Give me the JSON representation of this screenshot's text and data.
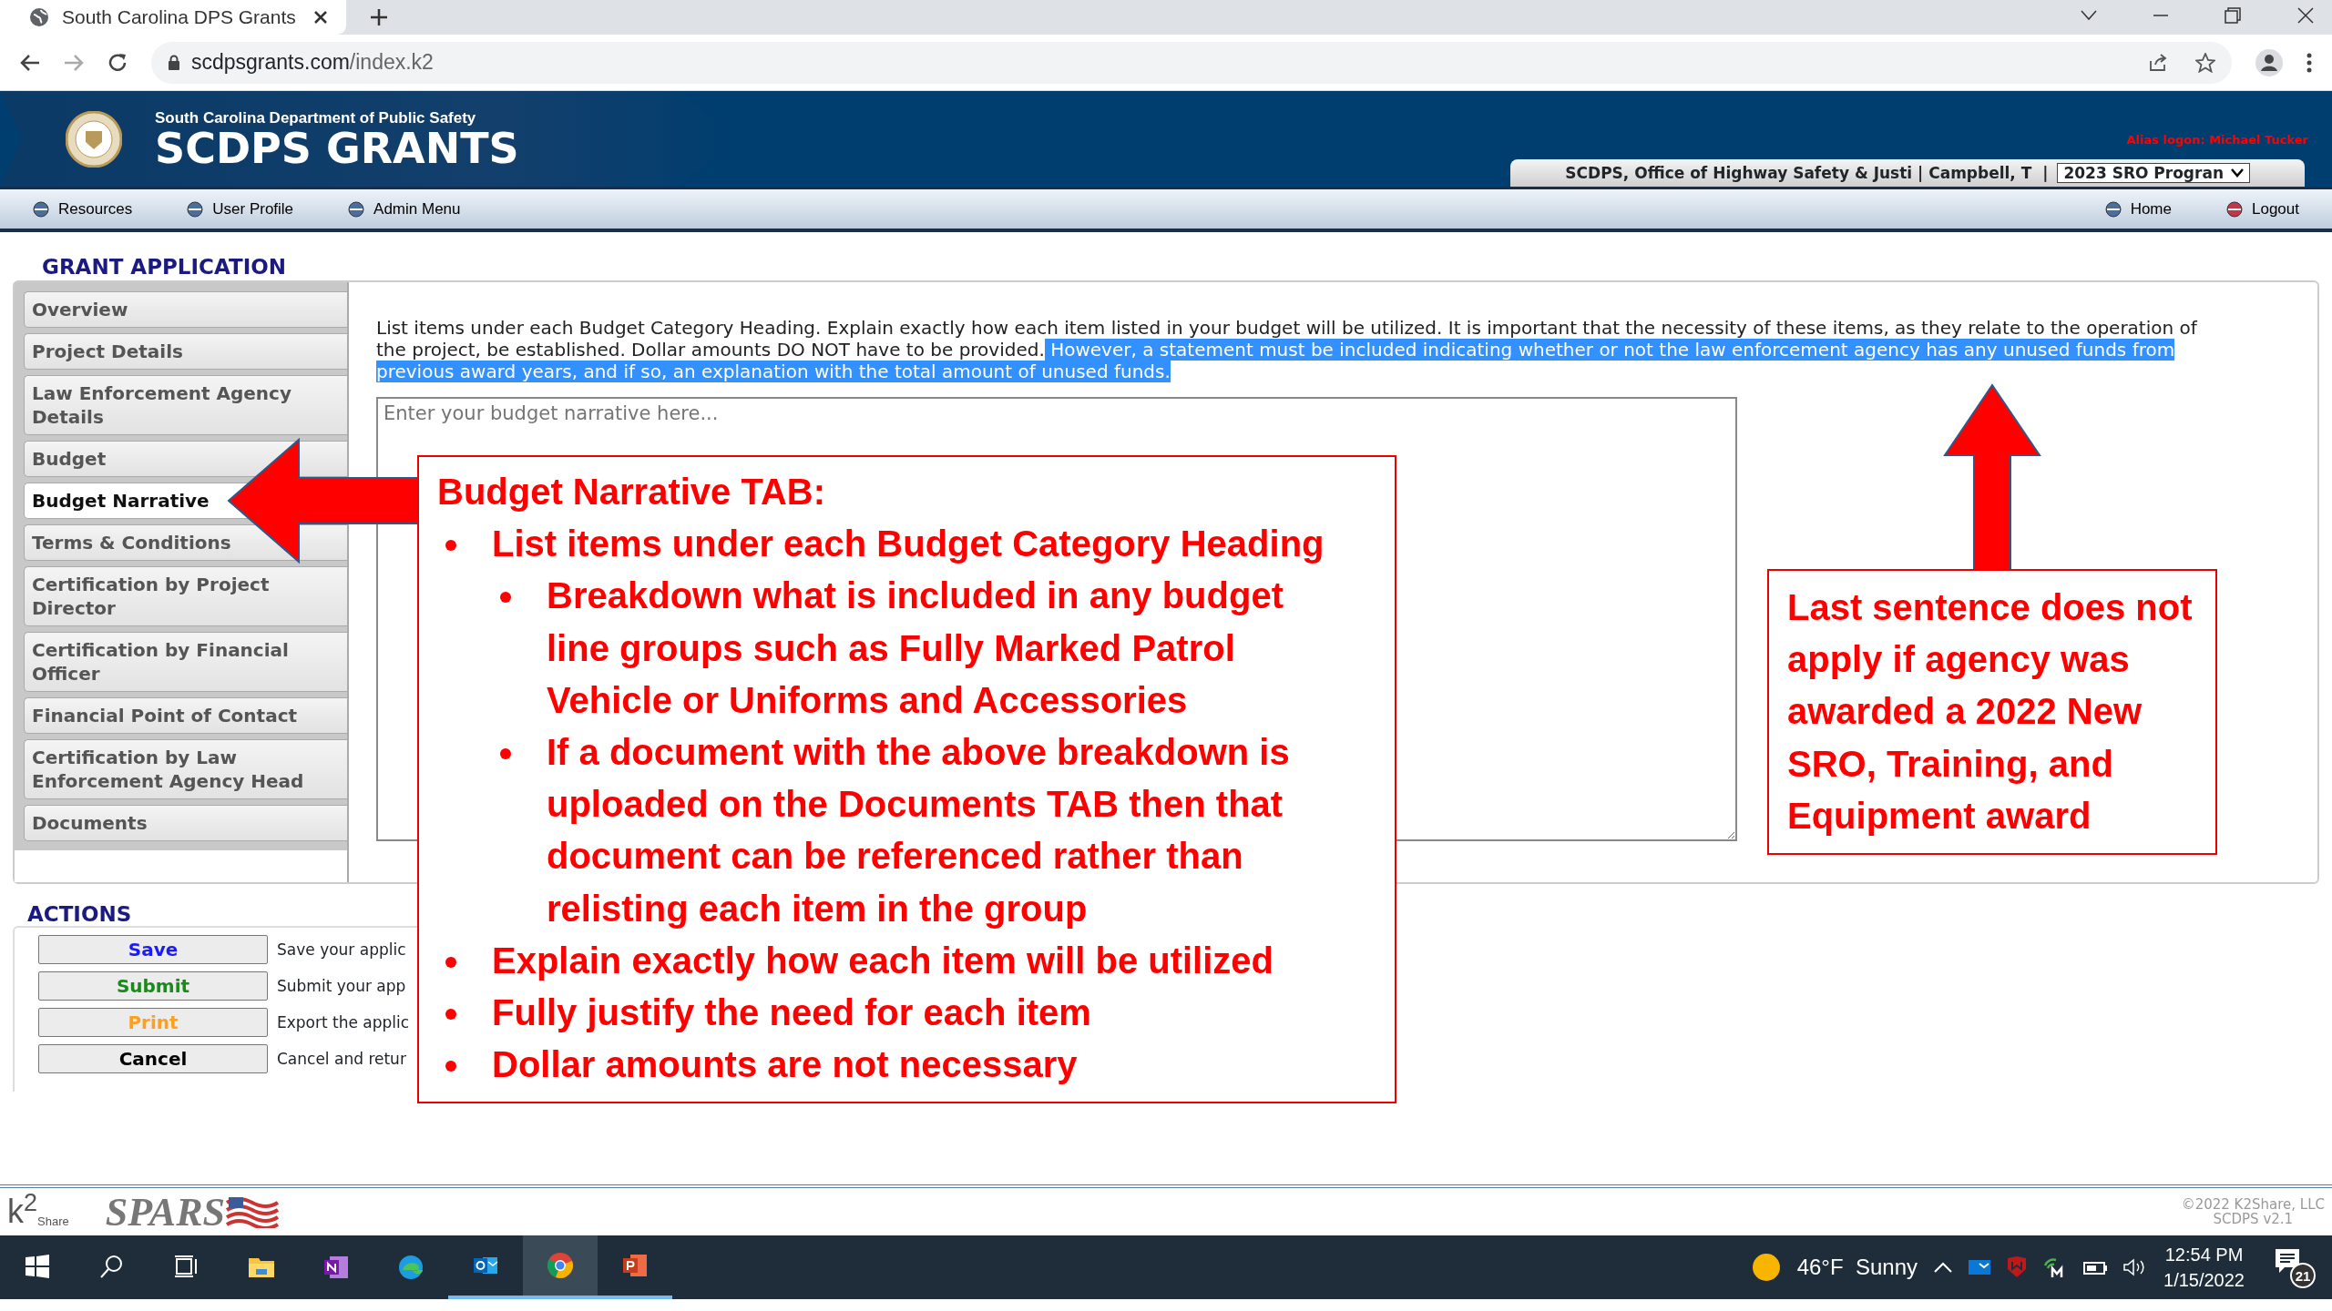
{
  "browser": {
    "tab_title": "South Carolina DPS Grants",
    "url_host": "scdpsgrants.com",
    "url_path": "/index.k2"
  },
  "header": {
    "agency": "South Carolina Department of Public Safety",
    "title": "SCDPS GRANTS",
    "alias_label": "Alias logon:",
    "alias_name": "Michael Tucker",
    "org_bar": "SCDPS, Office of Highway Safety & Justi | Campbell, T  |",
    "program": "2023 SRO Progran"
  },
  "nav": {
    "left": [
      {
        "label": "Resources",
        "kind": "blue"
      },
      {
        "label": "User Profile",
        "kind": "blue"
      },
      {
        "label": "Admin Menu",
        "kind": "blue"
      }
    ],
    "right": [
      {
        "label": "Home",
        "kind": "blue"
      },
      {
        "label": "Logout",
        "kind": "red"
      }
    ]
  },
  "grant_application": {
    "title": "GRANT APPLICATION",
    "sections": [
      {
        "label": "Overview",
        "selected": false
      },
      {
        "label": "Project Details",
        "selected": false
      },
      {
        "label": "Law Enforcement Agency Details",
        "selected": false
      },
      {
        "label": "Budget",
        "selected": false
      },
      {
        "label": "Budget Narrative",
        "selected": true
      },
      {
        "label": "Terms & Conditions",
        "selected": false
      },
      {
        "label": "Certification by Project Director",
        "selected": false
      },
      {
        "label": "Certification by Financial Officer",
        "selected": false
      },
      {
        "label": "Financial Point of Contact",
        "selected": false
      },
      {
        "label": "Certification by Law Enforcement Agency Head",
        "selected": false
      },
      {
        "label": "Documents",
        "selected": false
      }
    ]
  },
  "instructions": [
    {
      "text": "List items under each Budget Category Heading. Explain exactly how each item listed in your budget will be utilized. It is important that the necessity of these items, as they relate to the operation of the project, be established. Dollar amounts DO NOT have to be provided.",
      "selected": false
    },
    {
      "text": " However, a statement must be included indicating whether or not the law enforcement agency has any unused funds from previous award years, and if so, an explanation with the total amount of unused funds.",
      "selected": true
    }
  ],
  "narrative": {
    "placeholder": "Enter your budget narrative here..."
  },
  "actions": {
    "title": "ACTIONS",
    "buttons": [
      {
        "label": "Save",
        "kind": "save",
        "description": "Save your applic"
      },
      {
        "label": "Submit",
        "kind": "submit",
        "description": "Submit your app"
      },
      {
        "label": "Print",
        "kind": "print",
        "description": "Export the applic"
      },
      {
        "label": "Cancel",
        "kind": "cancel",
        "description": "Cancel and retur"
      }
    ]
  },
  "footer": {
    "k2_logo": "k$^{2}$",
    "k2_word": "Share",
    "spars_logo": "SPARS",
    "copyright": "©2022 K2Share, LLC",
    "version": "SCDPS v2.1"
  },
  "taskbar": {
    "apps": [
      {
        "kind": "start",
        "selected": false,
        "running": false
      },
      {
        "kind": "search",
        "selected": false,
        "running": false
      },
      {
        "kind": "taskview",
        "selected": false,
        "running": false
      },
      {
        "kind": "explorer",
        "selected": false,
        "running": false
      },
      {
        "kind": "onenote",
        "selected": false,
        "running": false
      },
      {
        "kind": "edge",
        "selected": false,
        "running": false
      },
      {
        "kind": "outlook",
        "selected": false,
        "running": true
      },
      {
        "kind": "chrome",
        "selected": true,
        "running": true
      },
      {
        "kind": "powerpoint",
        "selected": false,
        "running": true
      }
    ],
    "temperature": "46°F",
    "weather": "Sunny",
    "time": "12:54 PM",
    "date": "1/15/2022",
    "notifications": "21"
  },
  "annotations": {
    "main_callout": {
      "title": "Budget Narrative TAB:",
      "bullets": [
        {
          "text": "List items under each Budget Category Heading",
          "children": [
            {
              "text": "Breakdown what is included in any budget line groups such as Fully Marked Patrol Vehicle or Uniforms and Accessories"
            },
            {
              "text": "If a document with the above breakdown is uploaded on the Documents TAB then that document can be referenced rather than relisting each item in the group"
            }
          ]
        },
        {
          "text": "Explain exactly how each item will be utilized"
        },
        {
          "text": "Fully justify the need for each item"
        },
        {
          "text": "Dollar amounts are not necessary"
        }
      ]
    },
    "side_callout": "Last sentence does not apply if agency was awarded a 2022 New SRO, Training, and Equipment award"
  }
}
